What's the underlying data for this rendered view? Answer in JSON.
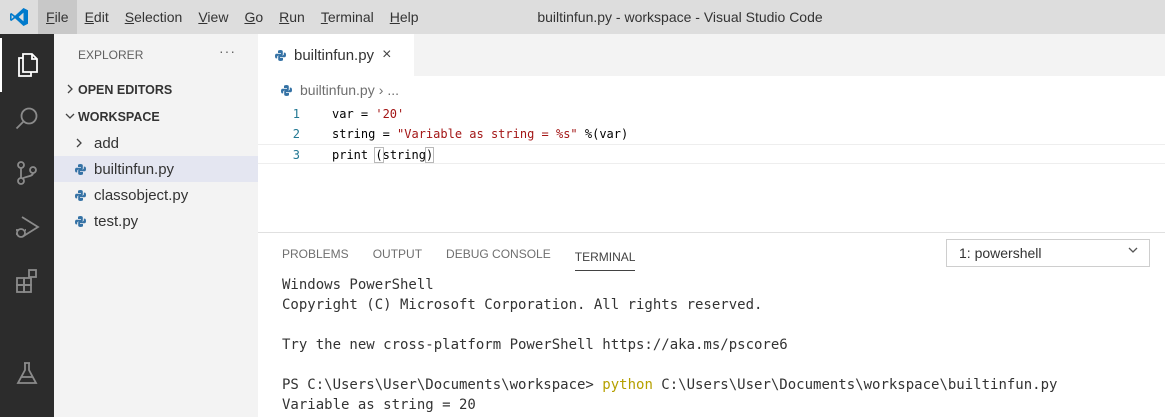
{
  "window": {
    "title": "builtinfun.py - workspace - Visual Studio Code"
  },
  "menu": [
    {
      "mn": "F",
      "rest": "ile"
    },
    {
      "mn": "E",
      "rest": "dit"
    },
    {
      "mn": "S",
      "rest": "election"
    },
    {
      "mn": "V",
      "rest": "iew"
    },
    {
      "mn": "G",
      "rest": "o"
    },
    {
      "mn": "R",
      "rest": "un"
    },
    {
      "mn": "T",
      "rest": "erminal"
    },
    {
      "mn": "H",
      "rest": "elp"
    }
  ],
  "sidebar": {
    "title": "EXPLORER",
    "more": "···",
    "open_editors": "OPEN EDITORS",
    "workspace": "WORKSPACE",
    "items": [
      {
        "label": "add",
        "type": "folder"
      },
      {
        "label": "builtinfun.py",
        "type": "python"
      },
      {
        "label": "classobject.py",
        "type": "python"
      },
      {
        "label": "test.py",
        "type": "python"
      }
    ]
  },
  "editor": {
    "tab_label": "builtinfun.py",
    "tab_close": "×",
    "breadcrumb_file": "builtinfun.py",
    "breadcrumb_sep": "›",
    "breadcrumb_more": "...",
    "lines": [
      {
        "n": "1"
      },
      {
        "n": "2"
      },
      {
        "n": "3"
      }
    ],
    "code": {
      "l1_a": "var = ",
      "l1_str": "'20'",
      "l2_a": "string = ",
      "l2_str": "\"Variable as string = %s\"",
      "l2_b": " %(var)",
      "l3_a": "print ",
      "l3_open": "(",
      "l3_mid": "string",
      "l3_close": ")"
    }
  },
  "panel": {
    "tabs": [
      "PROBLEMS",
      "OUTPUT",
      "DEBUG CONSOLE",
      "TERMINAL"
    ],
    "terminal_selected": "1: powershell",
    "terminal": {
      "line1": "Windows PowerShell",
      "line2": "Copyright (C) Microsoft Corporation. All rights reserved.",
      "line3": "Try the new cross-platform PowerShell https://aka.ms/pscore6",
      "prompt": "PS C:\\Users\\User\\Documents\\workspace> ",
      "cmd": "python",
      "cmd_args": " C:\\Users\\User\\Documents\\workspace\\builtinfun.py",
      "output": "Variable as string = 20"
    }
  },
  "colors": {
    "activity_bar": "#2c2c2c",
    "sidebar": "#f3f3f3",
    "title_bar": "#dddddd",
    "accent_logo": "#007acc",
    "python_icon": "#3572a5"
  }
}
